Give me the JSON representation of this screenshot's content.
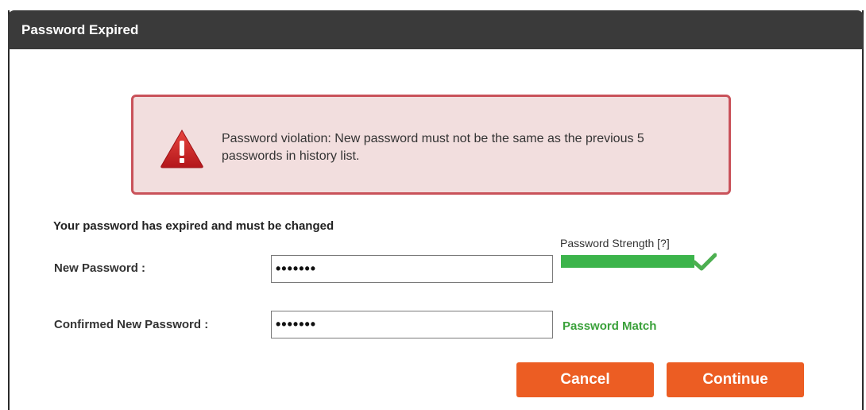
{
  "dialog": {
    "title": "Password Expired"
  },
  "alert": {
    "icon": "warning-triangle-icon",
    "message": "Password violation: New password must not be the same as the previous 5 passwords in history list."
  },
  "form": {
    "intro": "Your password has expired and must be changed",
    "new_password_label": "New Password :",
    "new_password_value": "•••••••",
    "confirm_password_label": "Confirmed New Password :",
    "confirm_password_value": "•••••••",
    "strength_label": "Password Strength [?]",
    "strength_level": 1.0,
    "strength_icon": "checkmark-icon",
    "match_text": "Password Match"
  },
  "buttons": {
    "cancel": "Cancel",
    "continue": "Continue"
  },
  "colors": {
    "titlebar": "#3a3a3a",
    "alert_bg": "#f2dede",
    "alert_border": "#c9525a",
    "strength": "#3cb44b",
    "match": "#3aa13a",
    "button": "#ec5d23"
  }
}
